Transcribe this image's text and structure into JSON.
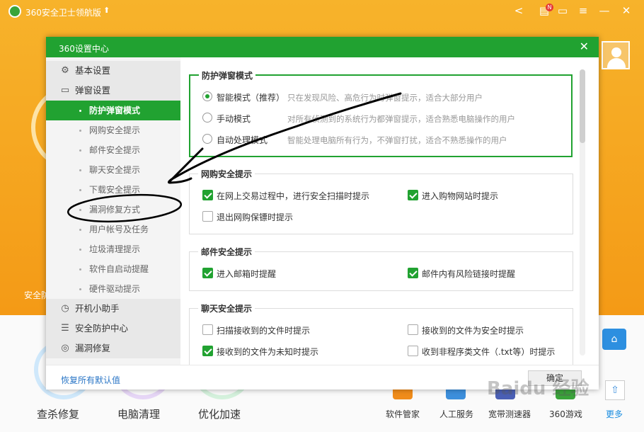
{
  "app": {
    "title": "360安全卫士领航版",
    "title_arrow": "⬆",
    "side_label": "安全防",
    "bottom_tools": [
      {
        "label": "查杀修复",
        "ring_color": "#cfe8fb"
      },
      {
        "label": "电脑清理",
        "ring_color": "#e6d6f6"
      },
      {
        "label": "优化加速",
        "ring_color": "#d4f1dc"
      }
    ],
    "right_tools": [
      {
        "label": "软件管家",
        "color": "#f08c1a"
      },
      {
        "label": "人工服务",
        "color": "#3d8fdc"
      },
      {
        "label": "宽带测速器",
        "color": "#4a5fb5"
      },
      {
        "label": "360游戏",
        "color": "#3aa43a"
      }
    ],
    "more_label": "更多",
    "icons": {
      "logo": "360-logo-icon",
      "share": "share-icon",
      "messages": "notification-icon",
      "chat": "feedback-icon",
      "menu": "menu-icon",
      "minimize": "minimize-icon",
      "close": "close-icon"
    },
    "notification_badge": "N",
    "accent_color": "#21a231",
    "window_bg": "#f49a16"
  },
  "dialog": {
    "title": "360设置中心",
    "close_glyph": "✕",
    "nav": {
      "groups": [
        {
          "label": "基本设置",
          "icon": "gear-icon",
          "glyph": "⚙"
        },
        {
          "label": "弹窗设置",
          "icon": "window-icon",
          "glyph": "▭"
        },
        {
          "label": "开机小助手",
          "icon": "clock-icon",
          "glyph": "◷"
        },
        {
          "label": "安全防护中心",
          "icon": "shield-icon",
          "glyph": "☰"
        },
        {
          "label": "漏洞修复",
          "icon": "wrench-icon",
          "glyph": "◎"
        }
      ],
      "items": [
        {
          "label": "防护弹窗模式",
          "active": true
        },
        {
          "label": "网购安全提示"
        },
        {
          "label": "邮件安全提示"
        },
        {
          "label": "聊天安全提示"
        },
        {
          "label": "下载安全提示"
        },
        {
          "label": "漏洞修复方式"
        },
        {
          "label": "用户帐号及任务"
        },
        {
          "label": "垃圾清理提示"
        },
        {
          "label": "软件自启动提醒"
        },
        {
          "label": "硬件驱动提示"
        }
      ]
    },
    "sections": {
      "popup_mode": {
        "title": "防护弹窗模式",
        "options": [
          {
            "label": "智能模式（推荐）",
            "desc": "只在发现风险、高危行为时弹窗提示，适合大部分用户",
            "checked": true
          },
          {
            "label": "手动模式",
            "desc": "对所有侦测到的系统行为都弹窗提示，适合熟悉电脑操作的用户",
            "checked": false
          },
          {
            "label": "自动处理模式",
            "desc": "智能处理电脑所有行为，不弹窗打扰，适合不熟悉操作的用户",
            "checked": false
          }
        ]
      },
      "shopping": {
        "title": "网购安全提示",
        "options": [
          {
            "label": "在网上交易过程中，进行安全扫描时提示",
            "checked": true
          },
          {
            "label": "进入购物网站时提示",
            "checked": true
          },
          {
            "label": "退出网购保镖时提示",
            "checked": false
          }
        ]
      },
      "mail": {
        "title": "邮件安全提示",
        "options": [
          {
            "label": "进入邮箱时提醒",
            "checked": true
          },
          {
            "label": "邮件内有风险链接时提醒",
            "checked": true
          }
        ]
      },
      "chat": {
        "title": "聊天安全提示",
        "options": [
          {
            "label": "扫描接收到的文件时提示",
            "checked": false
          },
          {
            "label": "接收到的文件为安全时提示",
            "checked": false
          },
          {
            "label": "接收到的文件为未知时提示",
            "checked": true
          },
          {
            "label": "收到非程序类文件（.txt等）时提示",
            "checked": false
          }
        ]
      }
    },
    "footer": {
      "restore_label": "恢复所有默认值",
      "ok_label": "确定"
    }
  },
  "watermark": "Baidu 经验"
}
